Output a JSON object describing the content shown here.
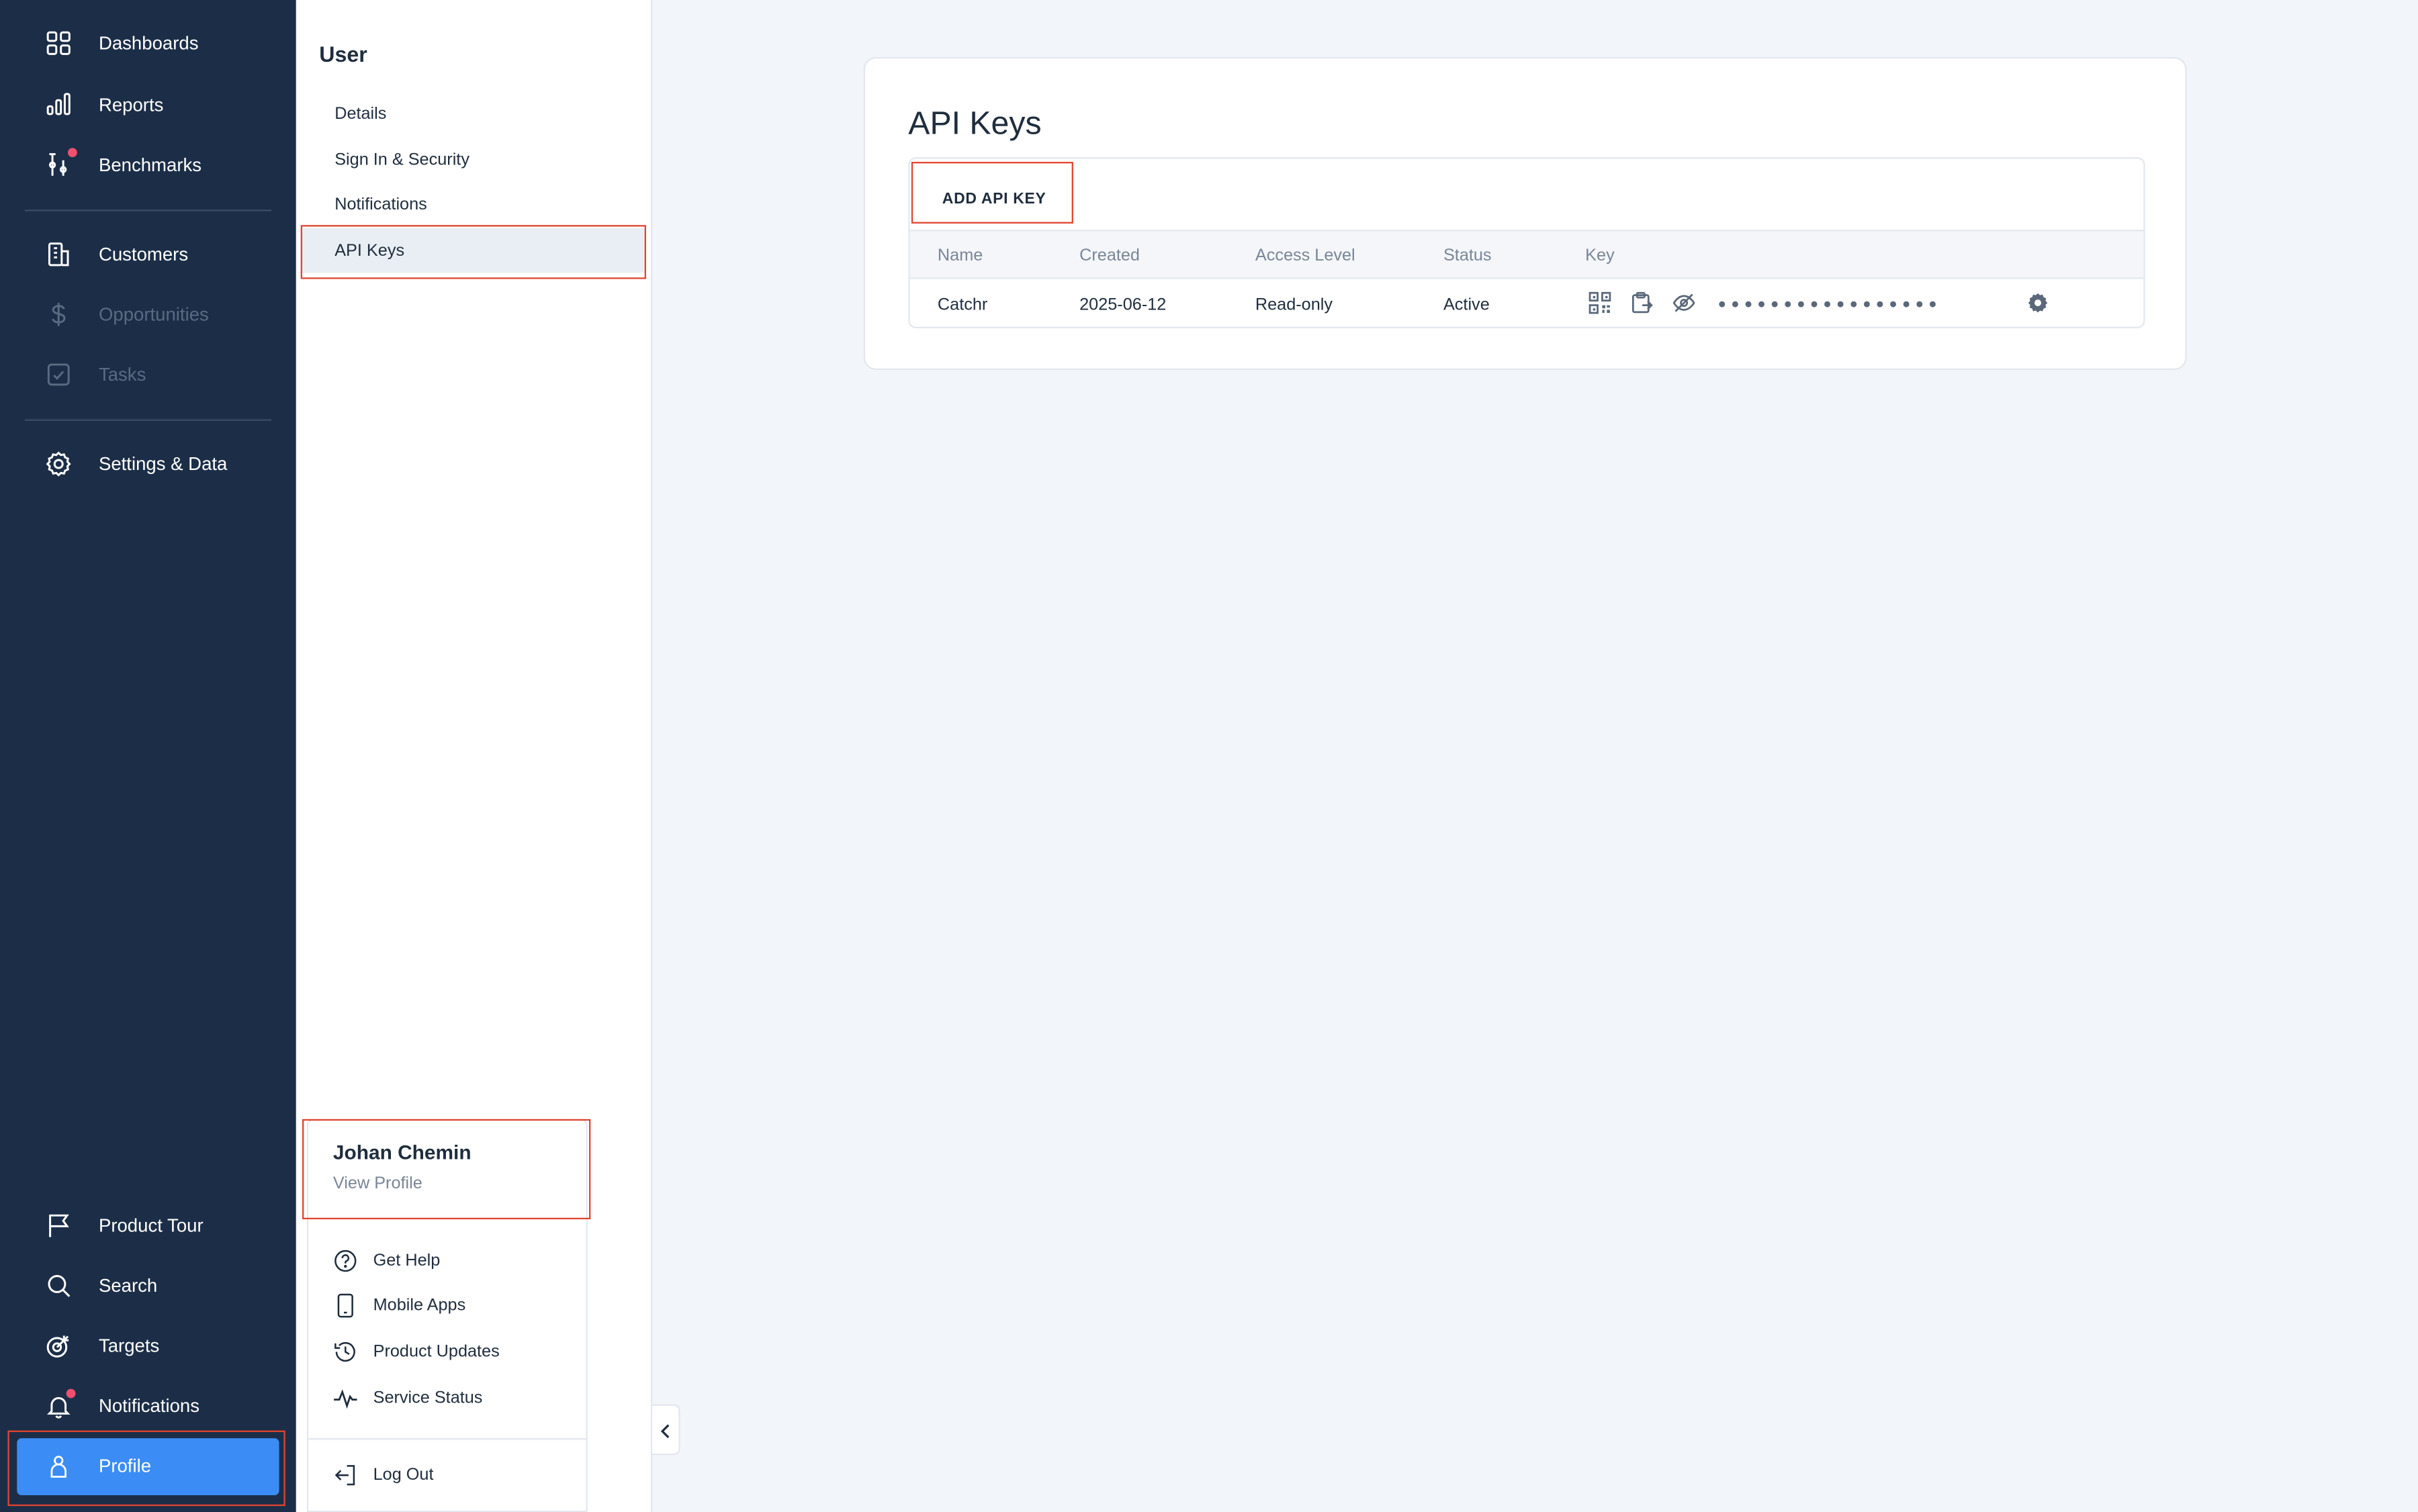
{
  "nav": {
    "top_items": [
      {
        "label": "Dashboards",
        "icon": "grid-icon"
      },
      {
        "label": "Reports",
        "icon": "bar-chart-icon"
      },
      {
        "label": "Benchmarks",
        "icon": "benchmark-icon"
      }
    ],
    "mid_items": [
      {
        "label": "Customers",
        "icon": "building-icon"
      },
      {
        "label": "Opportunities",
        "icon": "dollar-icon"
      },
      {
        "label": "Tasks",
        "icon": "checkbox-icon"
      }
    ],
    "settings_item": {
      "label": "Settings & Data",
      "icon": "gear-icon"
    },
    "bottom_items": [
      {
        "label": "Product Tour",
        "icon": "flag-icon"
      },
      {
        "label": "Search",
        "icon": "search-icon"
      },
      {
        "label": "Targets",
        "icon": "target-icon"
      },
      {
        "label": "Notifications",
        "icon": "bell-icon"
      }
    ],
    "profile": {
      "label": "Profile",
      "icon": "person-icon"
    },
    "colors": {
      "background": "#1c2e47",
      "active": "#3b8cf5",
      "badge": "#f0506e"
    }
  },
  "settings_panel": {
    "heading": "User",
    "items": [
      "Details",
      "Sign In & Security",
      "Notifications",
      "API Keys"
    ],
    "active": "API Keys"
  },
  "main": {
    "title": "API Keys",
    "add_button": "ADD API KEY",
    "columns": [
      "Name",
      "Created",
      "Access Level",
      "Status",
      "Key"
    ],
    "rows": [
      {
        "name": "Catchr",
        "created": "2025-06-12",
        "access_level": "Read-only",
        "status": "Active",
        "key_masked": "●●●●●●●●●●●●●●●●●"
      }
    ]
  },
  "profile_menu": {
    "user_name": "Johan Chemin",
    "view_profile": "View Profile",
    "items": [
      {
        "label": "Get Help",
        "icon": "help-circle-icon"
      },
      {
        "label": "Mobile Apps",
        "icon": "phone-icon"
      },
      {
        "label": "Product Updates",
        "icon": "history-icon"
      },
      {
        "label": "Service Status",
        "icon": "activity-icon"
      }
    ],
    "logout": {
      "label": "Log Out",
      "icon": "logout-icon"
    }
  },
  "highlight_color": "#e0452f"
}
